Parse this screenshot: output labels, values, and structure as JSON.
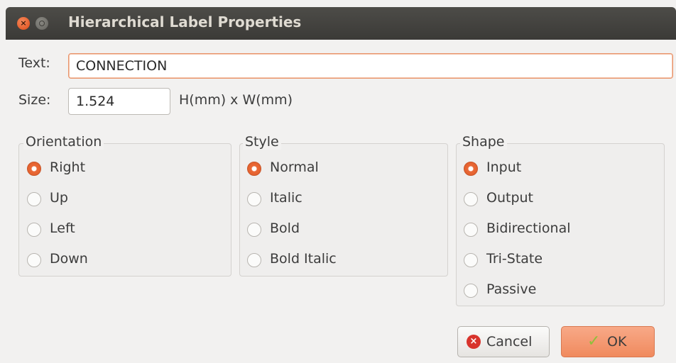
{
  "window": {
    "title": "Hierarchical Label Properties"
  },
  "form": {
    "text_label": "Text:",
    "text_value": "CONNECTION",
    "size_label": "Size:",
    "size_value": "1.524",
    "size_units": "H(mm) x W(mm)"
  },
  "orientation": {
    "title": "Orientation",
    "options": [
      {
        "label": "Right",
        "selected": true
      },
      {
        "label": "Up",
        "selected": false
      },
      {
        "label": "Left",
        "selected": false
      },
      {
        "label": "Down",
        "selected": false
      }
    ]
  },
  "style": {
    "title": "Style",
    "options": [
      {
        "label": "Normal",
        "selected": true
      },
      {
        "label": "Italic",
        "selected": false
      },
      {
        "label": "Bold",
        "selected": false
      },
      {
        "label": "Bold Italic",
        "selected": false
      }
    ]
  },
  "shape": {
    "title": "Shape",
    "options": [
      {
        "label": "Input",
        "selected": true
      },
      {
        "label": "Output",
        "selected": false
      },
      {
        "label": "Bidirectional",
        "selected": false
      },
      {
        "label": "Tri-State",
        "selected": false
      },
      {
        "label": "Passive",
        "selected": false
      }
    ]
  },
  "buttons": {
    "cancel": "Cancel",
    "ok": "OK"
  },
  "colors": {
    "accent": "#e05a26",
    "titlebar": "#3b3a37",
    "ok_button": "#f08a5e",
    "cancel_icon": "#d8342c"
  }
}
